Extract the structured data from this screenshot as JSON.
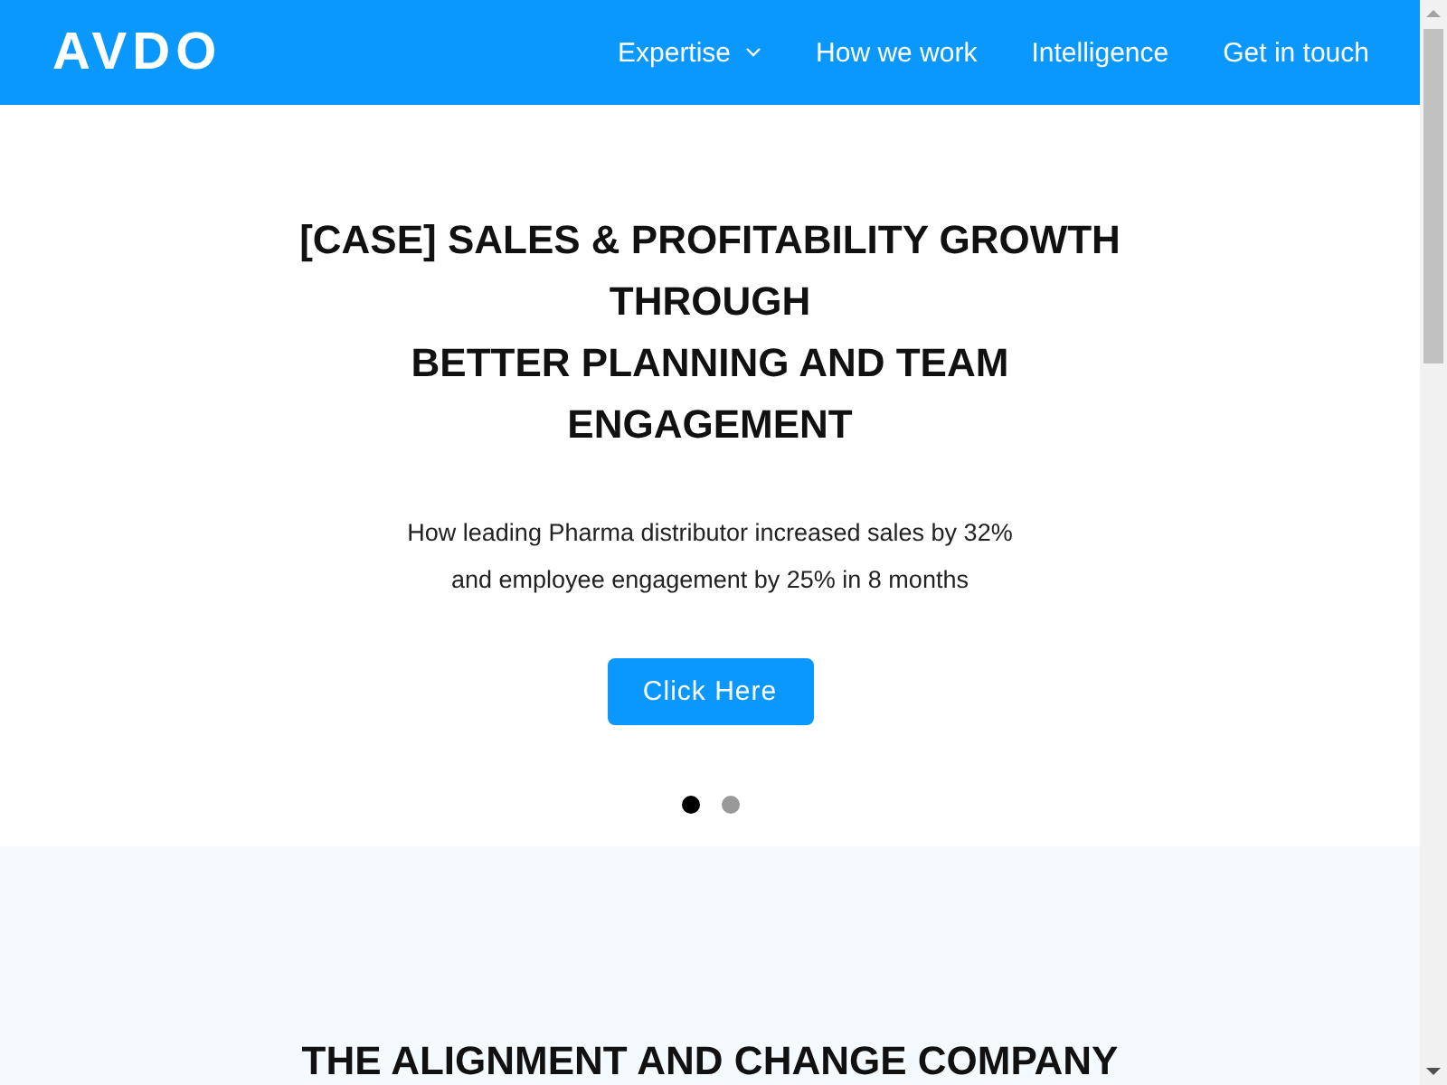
{
  "header": {
    "logo": "AVDO",
    "nav": [
      {
        "label": "Expertise",
        "kind": "dropdown"
      },
      {
        "label": "How we work",
        "kind": "link"
      },
      {
        "label": "Intelligence",
        "kind": "link"
      },
      {
        "label": "Get in touch",
        "kind": "link"
      }
    ]
  },
  "hero": {
    "title_lines": [
      "[CASE] SALES & PROFITABILITY GROWTH THROUGH",
      "BETTER PLANNING AND TEAM ENGAGEMENT"
    ],
    "subtitle_lines": [
      "How leading Pharma distributor increased sales by 32%",
      "and employee engagement by 25% in 8 months"
    ],
    "button": "Click Here",
    "slides": [
      {
        "selected": true
      },
      {
        "selected": false
      }
    ]
  },
  "about": {
    "heading": "THE ALIGNMENT AND CHANGE COMPANY"
  }
}
